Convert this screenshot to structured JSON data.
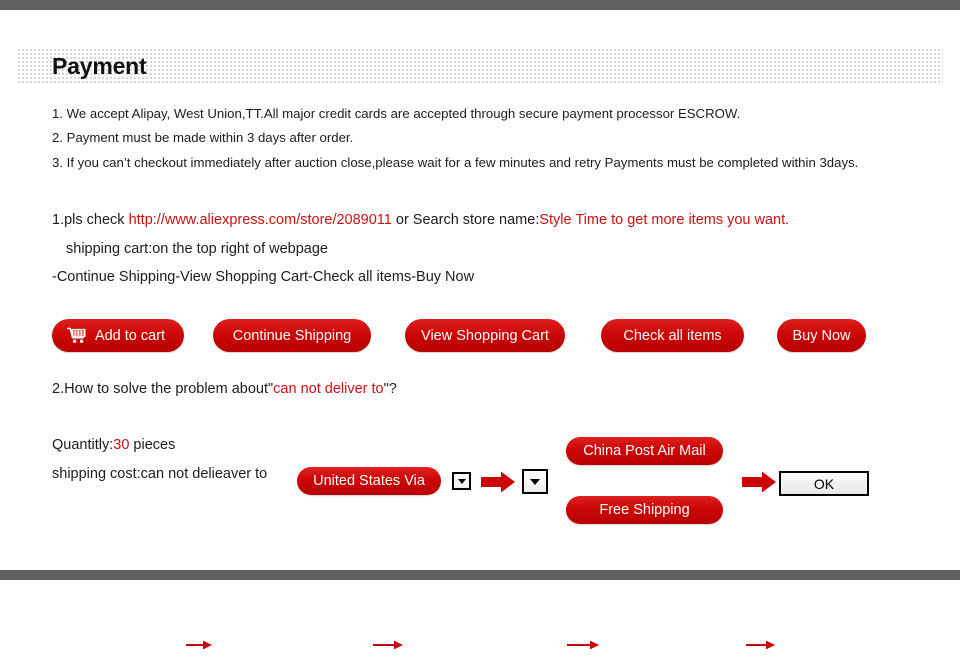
{
  "header": {
    "title": "Payment"
  },
  "terms": {
    "line1": "1. We accept Alipay, West Union,TT.All major credit cards are accepted through secure payment processor ESCROW.",
    "line2": "2. Payment must be made within 3 days after order.",
    "line3": "3. If you can’t checkout immediately after auction close,please wait for a few minutes and retry Payments must be completed within 3days."
  },
  "store": {
    "step1_prefix": "1.pls check ",
    "store_url": "http://www.aliexpress.com/store/2089011",
    "step1_middle": " or Search store name:",
    "store_name_phrase": "Style Time to get more items you want.",
    "cart_hint": "shipping cart:on the top right of webpage",
    "flow_text": "-Continue Shipping-View Shopping Cart-Check all items-Buy Now"
  },
  "flow_buttons": [
    {
      "label": "Add to cart",
      "icon": "shopping-cart-icon"
    },
    {
      "label": "Continue Shipping",
      "icon": ""
    },
    {
      "label": "View Shopping Cart",
      "icon": ""
    },
    {
      "label": "Check all items",
      "icon": ""
    },
    {
      "label": "Buy Now",
      "icon": ""
    }
  ],
  "problem": {
    "prefix": "2.How to solve the problem about\"",
    "highlight": "can not deliver to",
    "suffix": "\"?"
  },
  "order": {
    "quantity_label": "Quantitly:",
    "quantity_value": "30",
    "quantity_unit": " pieces",
    "shipping_label": "shipping cost:can not delieaver to",
    "destination_pill": "United States Via",
    "shipping_option_1": "China Post Air Mail",
    "shipping_option_2": "Free Shipping",
    "confirm_label": "OK",
    "dropdown_small_icon": "chevron-down-icon",
    "dropdown_large_icon": "chevron-down-icon"
  },
  "colors": {
    "accent_red": "#cc0606",
    "link_red": "#cc1111",
    "rail_gray": "#616161",
    "text": "#1c1c1c"
  }
}
